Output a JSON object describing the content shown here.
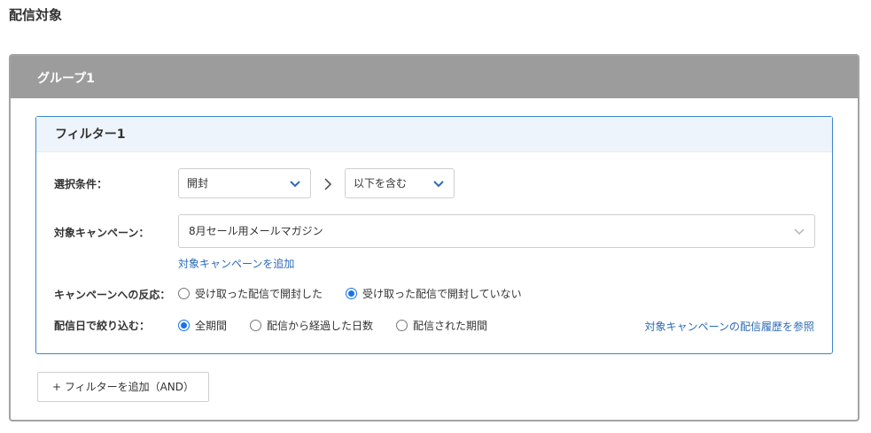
{
  "page": {
    "title": "配信対象"
  },
  "group": {
    "title": "グループ1",
    "filter": {
      "title": "フィルター1",
      "condition": {
        "label": "選択条件：",
        "select1": "開封",
        "select2": "以下を含む"
      },
      "campaign": {
        "label": "対象キャンペーン：",
        "value": "8月セール用メールマガジン",
        "add_link": "対象キャンペーンを追加"
      },
      "reaction": {
        "label": "キャンペーンへの反応：",
        "options": [
          "受け取った配信で開封した",
          "受け取った配信で開封していない"
        ],
        "selected": 1
      },
      "date_filter": {
        "label": "配信日で絞り込む：",
        "options": [
          "全期間",
          "配信から経過した日数",
          "配信された期間"
        ],
        "selected": 0,
        "history_link": "対象キャンペーンの配信履歴を参照"
      }
    },
    "add_filter_button": "+ フィルターを追加（AND）"
  },
  "colors": {
    "accent": "#1a73e8",
    "link": "#2d6bb5",
    "group_header": "#9c9c9c",
    "filter_border": "#3d86cc"
  },
  "icons": {
    "select_chevron": "chevron-down-icon",
    "separator": "chevron-right-icon"
  }
}
